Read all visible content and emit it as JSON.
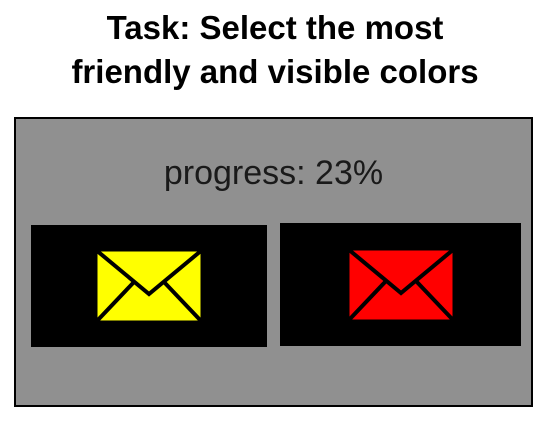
{
  "task": {
    "line1": "Task: Select the most",
    "line2": "friendly and visible colors"
  },
  "progress_text": "progress: 23%",
  "progress_value": 0.23,
  "options": [
    {
      "icon": "envelope-icon",
      "color": "#ffff00"
    },
    {
      "icon": "envelope-icon",
      "color": "#ff0000"
    }
  ],
  "colors": {
    "panel_background": "#909090",
    "option_background": "#000000",
    "icon_outline": "#000000"
  }
}
